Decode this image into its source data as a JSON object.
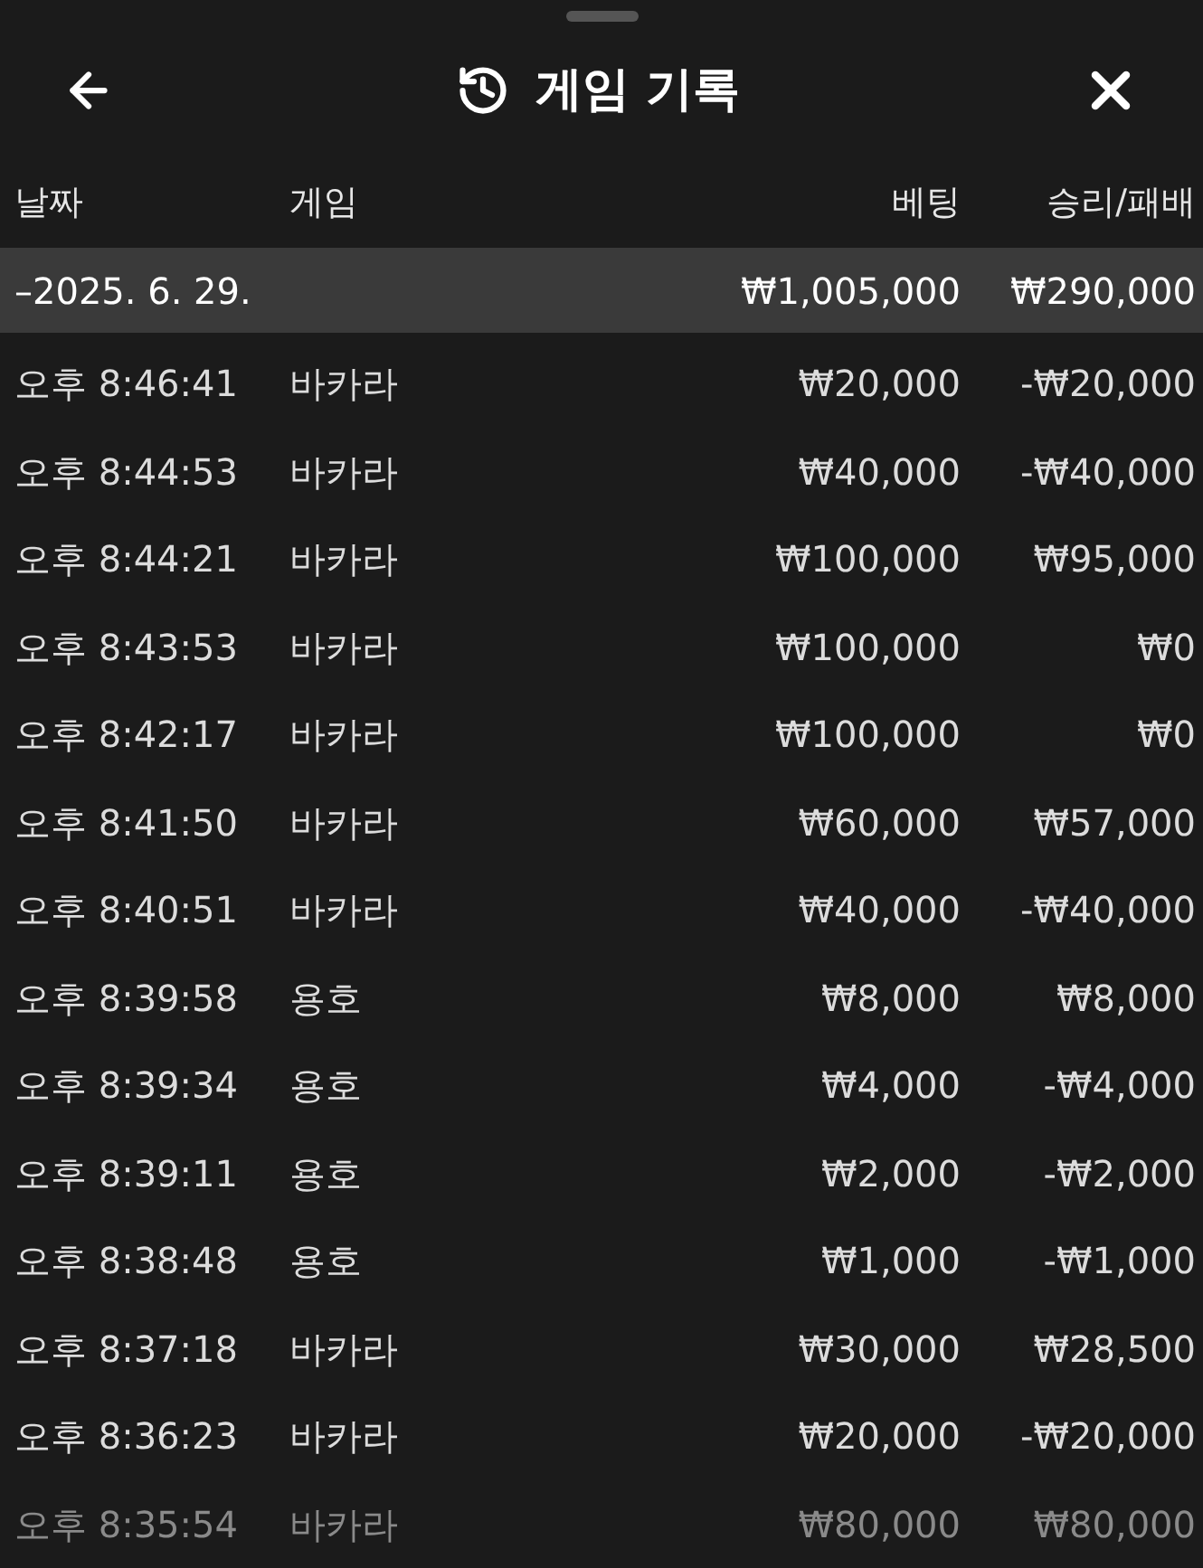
{
  "header": {
    "title": "게임 기록"
  },
  "table": {
    "columns": [
      "날짜",
      "게임",
      "베팅",
      "승리/패배"
    ],
    "group": {
      "label": "–2025. 6. 29.",
      "bet": "₩1,005,000",
      "result": "₩290,000"
    },
    "rows": [
      {
        "time": "오후 8:46:41",
        "game": "바카라",
        "bet": "₩20,000",
        "result": "-₩20,000"
      },
      {
        "time": "오후 8:44:53",
        "game": "바카라",
        "bet": "₩40,000",
        "result": "-₩40,000"
      },
      {
        "time": "오후 8:44:21",
        "game": "바카라",
        "bet": "₩100,000",
        "result": "₩95,000"
      },
      {
        "time": "오후 8:43:53",
        "game": "바카라",
        "bet": "₩100,000",
        "result": "₩0"
      },
      {
        "time": "오후 8:42:17",
        "game": "바카라",
        "bet": "₩100,000",
        "result": "₩0"
      },
      {
        "time": "오후 8:41:50",
        "game": "바카라",
        "bet": "₩60,000",
        "result": "₩57,000"
      },
      {
        "time": "오후 8:40:51",
        "game": "바카라",
        "bet": "₩40,000",
        "result": "-₩40,000"
      },
      {
        "time": "오후 8:39:58",
        "game": "용호",
        "bet": "₩8,000",
        "result": "₩8,000"
      },
      {
        "time": "오후 8:39:34",
        "game": "용호",
        "bet": "₩4,000",
        "result": "-₩4,000"
      },
      {
        "time": "오후 8:39:11",
        "game": "용호",
        "bet": "₩2,000",
        "result": "-₩2,000"
      },
      {
        "time": "오후 8:38:48",
        "game": "용호",
        "bet": "₩1,000",
        "result": "-₩1,000"
      },
      {
        "time": "오후 8:37:18",
        "game": "바카라",
        "bet": "₩30,000",
        "result": "₩28,500"
      },
      {
        "time": "오후 8:36:23",
        "game": "바카라",
        "bet": "₩20,000",
        "result": "-₩20,000"
      },
      {
        "time": "오후 8:35:54",
        "game": "바카라",
        "bet": "₩80,000",
        "result": "₩80,000"
      }
    ]
  }
}
